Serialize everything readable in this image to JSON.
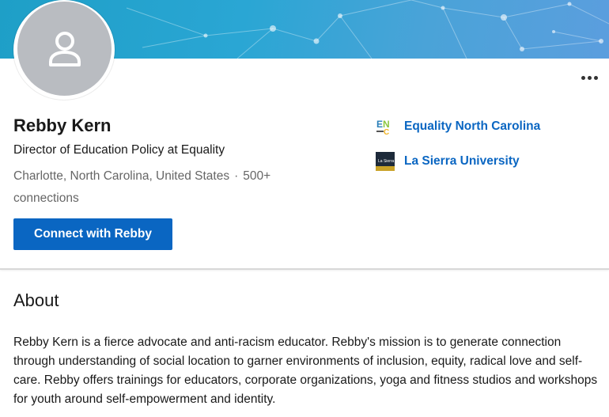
{
  "profile": {
    "name": "Rebby Kern",
    "headline": "Director of Education Policy at Equality",
    "location": "Charlotte, North Carolina, United States",
    "separator": "·",
    "connections": "500+ connections",
    "connect_label": "Connect with Rebby",
    "more_icon": "more-horizontal-icon",
    "avatar_icon": "person-silhouette-icon"
  },
  "organizations": [
    {
      "name": "Equality North Carolina",
      "logo_text": "ENC",
      "logo_icon": "equality-nc-logo"
    },
    {
      "name": "La Sierra University",
      "logo_text": "La Sierra",
      "logo_icon": "la-sierra-logo"
    }
  ],
  "about": {
    "title": "About",
    "text": "Rebby Kern is a fierce advocate and anti-racism educator. Rebby's mission is to generate connection through understanding of social location to garner environments of inclusion, equity, radical love and self-care. Rebby offers trainings for educators, corporate organizations, yoga and fitness studios and workshops for youth around self-empowerment and identity."
  },
  "colors": {
    "accent": "#0a66c2",
    "banner": "#2aa6d4",
    "avatar_bg": "#b9bcc1",
    "secondary_text": "#666666"
  }
}
